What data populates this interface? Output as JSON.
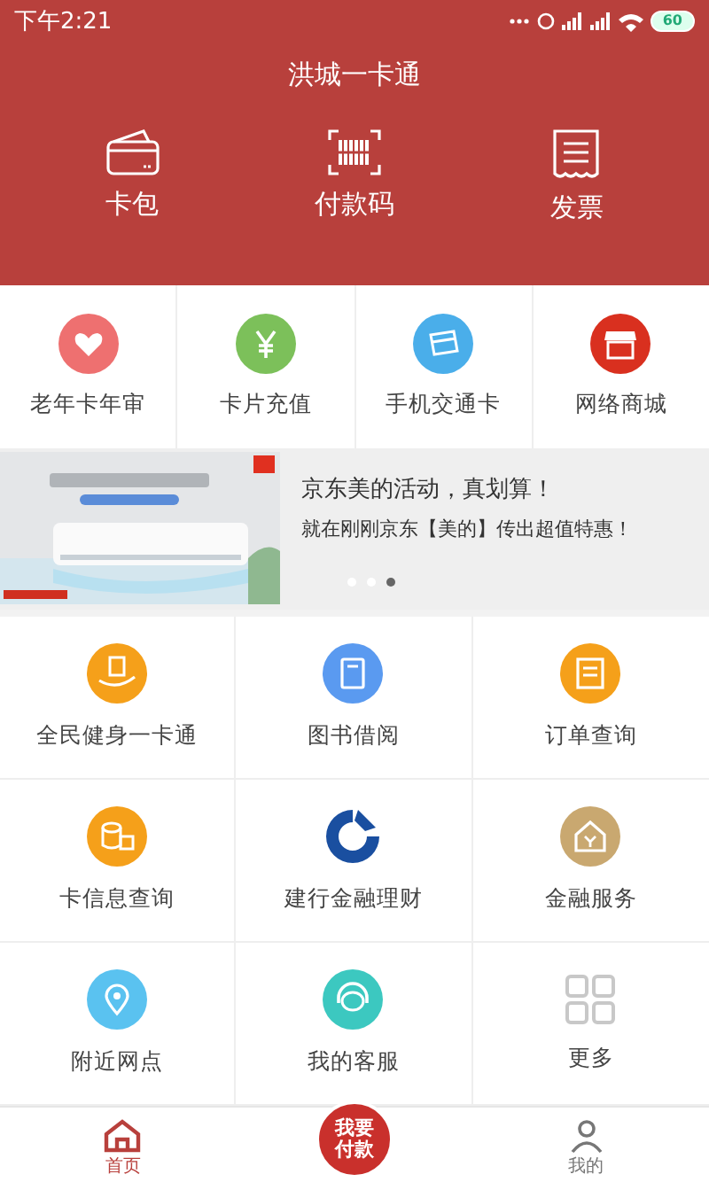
{
  "status_bar": {
    "time": "下午2:21",
    "battery": "60"
  },
  "header": {
    "title": "洪城一卡通"
  },
  "top_actions": [
    {
      "kind": "wallet",
      "label": "卡包"
    },
    {
      "kind": "barcode",
      "label": "付款码"
    },
    {
      "kind": "receipt",
      "label": "发票"
    }
  ],
  "quick_services": [
    {
      "kind": "heart",
      "label": "老年卡年审",
      "color": "#ee7070"
    },
    {
      "kind": "yen",
      "label": "卡片充值",
      "color": "#7cc05a"
    },
    {
      "kind": "card",
      "label": "手机交通卡",
      "color": "#4aaeea"
    },
    {
      "kind": "shop",
      "label": "网络商城",
      "color": "#d9301f"
    }
  ],
  "banner": {
    "headline": "京东美的活动，真划算！",
    "subtitle": "就在刚刚京东【美的】传出超值特惠！",
    "dots": [
      {
        "selected": false
      },
      {
        "selected": false
      },
      {
        "selected": true
      }
    ]
  },
  "services": [
    {
      "kind": "hand",
      "label": "全民健身一卡通",
      "color": "#f5a01a"
    },
    {
      "kind": "book",
      "label": "图书借阅",
      "color": "#5a9af0"
    },
    {
      "kind": "list",
      "label": "订单查询",
      "color": "#f5a01a"
    },
    {
      "kind": "coins",
      "label": "卡信息查询",
      "color": "#f5a01a"
    },
    {
      "kind": "bank",
      "label": "建行金融理财",
      "color": "#1a4fa0"
    },
    {
      "kind": "house",
      "label": "金融服务",
      "color": "#c9a870"
    },
    {
      "kind": "pin",
      "label": "附近网点",
      "color": "#5ac2f0"
    },
    {
      "kind": "headset",
      "label": "我的客服",
      "color": "#3cc8c0"
    },
    {
      "kind": "grid",
      "label": "更多",
      "color": "#c8c8c8"
    }
  ],
  "tab_bar": [
    {
      "kind": "home",
      "label": "首页",
      "selected": true
    },
    {
      "kind": "pay",
      "label": "我要付款",
      "selected": false
    },
    {
      "kind": "me",
      "label": "我的",
      "selected": false
    }
  ]
}
